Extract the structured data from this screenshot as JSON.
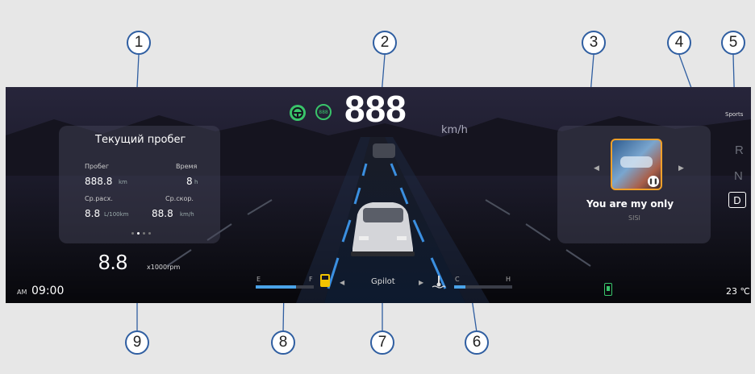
{
  "callouts": [
    "1",
    "2",
    "3",
    "4",
    "5",
    "6",
    "7",
    "8",
    "9"
  ],
  "speed": {
    "value": "888",
    "unit": "km/h",
    "limit": "888"
  },
  "trip": {
    "title": "Текущий пробег",
    "mileage_label": "Пробег",
    "mileage_value": "888.8",
    "mileage_unit": "km",
    "time_label": "Время",
    "time_value": "8",
    "time_unit": "h",
    "consumption_label": "Ср.расх.",
    "consumption_value": "8.8",
    "consumption_unit": "L/100km",
    "avg_speed_label": "Ср.скор.",
    "avg_speed_value": "88.8",
    "avg_speed_unit": "km/h"
  },
  "media": {
    "song_title": "You are my only",
    "artist": "SISI"
  },
  "gears": {
    "R": "R",
    "N": "N",
    "D": "D"
  },
  "drive_mode": "Sports",
  "rpm": {
    "value": "8.8",
    "unit": "x1000rpm"
  },
  "clock": {
    "ampm": "AM",
    "time": "09:00"
  },
  "fuel": {
    "empty": "E",
    "full": "F",
    "level": 0.7
  },
  "coolant": {
    "cold": "C",
    "hot": "H",
    "level": 0.2
  },
  "nav_mode": "Gpilot",
  "temperature": "23 ℃",
  "colors": {
    "accent_green": "#39c46a",
    "gauge_blue": "#4aa3e8",
    "callout_border": "#2f5ea1"
  }
}
